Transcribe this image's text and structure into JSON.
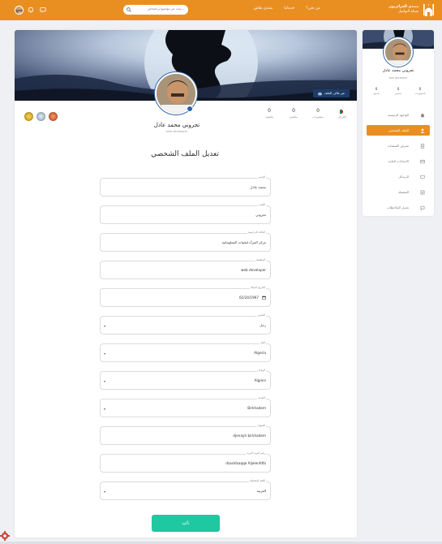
{
  "header": {
    "brand_title": "منتدى الجزائريون",
    "brand_subtitle": "شبكة التواصل",
    "nav": [
      "من نحن؟",
      "خدماتنا",
      "منتدى نقاش"
    ],
    "search_placeholder": "بحث عن مواضيع أو أشخاص..."
  },
  "profile": {
    "cover_button": "غير غلاف الملف",
    "name": "تجروني محمد عادل",
    "role": "web developer",
    "stats": [
      {
        "value": "",
        "label": "الجزائر"
      },
      {
        "value": "0",
        "label": "منشورات"
      },
      {
        "value": "0",
        "label": "متابعين"
      },
      {
        "value": "0",
        "label": "يتابعون"
      }
    ]
  },
  "form": {
    "title": "تعديل الملف الشخصي",
    "fields": [
      {
        "label": "الإسم",
        "value": "محمد عادل"
      },
      {
        "label": "اللقب",
        "value": "تجروني"
      },
      {
        "label": "الحالة الدراسية",
        "value": "مركز المرأة لتقنيات المعلوماتية"
      },
      {
        "label": "الوظيفة",
        "value": "web developer"
      },
      {
        "label": "التاريخ الميلاد",
        "value": "02/24/1997"
      },
      {
        "label": "الجنس",
        "value": "رجل"
      },
      {
        "label": "البلد",
        "value": "Algeria"
      },
      {
        "label": "الولاية",
        "value": "Algiers"
      },
      {
        "label": "البلدية",
        "value": "Birkhadem"
      },
      {
        "label": "العنوان",
        "value": "djenayh birkhadem"
      },
      {
        "label": "رقم البريد البريد",
        "value": "dsasldsaqqe Aljelenfdfa"
      },
      {
        "label": "اللغة المفضلة",
        "value": "العربية"
      }
    ],
    "submit": "تأكيد"
  },
  "sidebar": {
    "name": "تجروني محمد عادل",
    "role": "web developer",
    "stats": [
      {
        "value": "0",
        "label": "المنشورات"
      },
      {
        "value": "0",
        "label": "متابعين"
      },
      {
        "value": "0",
        "label": "يتابعون"
      }
    ],
    "menu": [
      {
        "label": "الواجهة الرئيسية",
        "icon": "home-icon"
      },
      {
        "label": "الملف الشخصي",
        "icon": "user-icon"
      },
      {
        "label": "معرض الصفحات",
        "icon": "pages-icon"
      },
      {
        "label": "الاعدادات العامة",
        "icon": "settings-icon"
      },
      {
        "label": "الرسائل",
        "icon": "messages-icon"
      },
      {
        "label": "المفضلة",
        "icon": "favorites-icon"
      },
      {
        "label": "تعديل الملاحظات",
        "icon": "notes-icon"
      }
    ]
  },
  "colors": {
    "primary": "#e98f22",
    "accent": "#1ec8a0",
    "navy": "#1b3c6b"
  }
}
